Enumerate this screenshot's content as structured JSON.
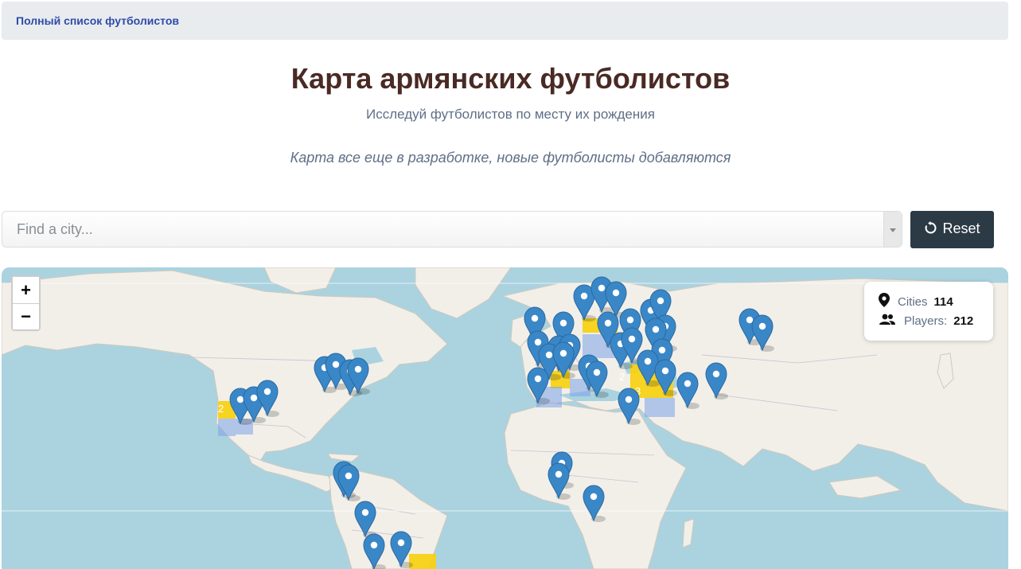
{
  "nav": {
    "link_label": "Полный список футболистов"
  },
  "header": {
    "title": "Карта армянских футболистов",
    "subtitle": "Исследуй футболистов по месту их рождения",
    "note": "Карта все еще в разработке, новые футболисты добавляются"
  },
  "search": {
    "placeholder": "Find a city...",
    "value": ""
  },
  "reset": {
    "label": "Reset",
    "icon": "reset-icon"
  },
  "map": {
    "zoom_in": "+",
    "zoom_out": "−",
    "stats": {
      "cities_label": "Cities",
      "cities_value": "114",
      "players_label": "Players:",
      "players_value": "212"
    },
    "cluster_labels": [
      "2",
      "2",
      "3"
    ],
    "marker_color": "#3a87c8",
    "heat_color": "#f7d117"
  }
}
